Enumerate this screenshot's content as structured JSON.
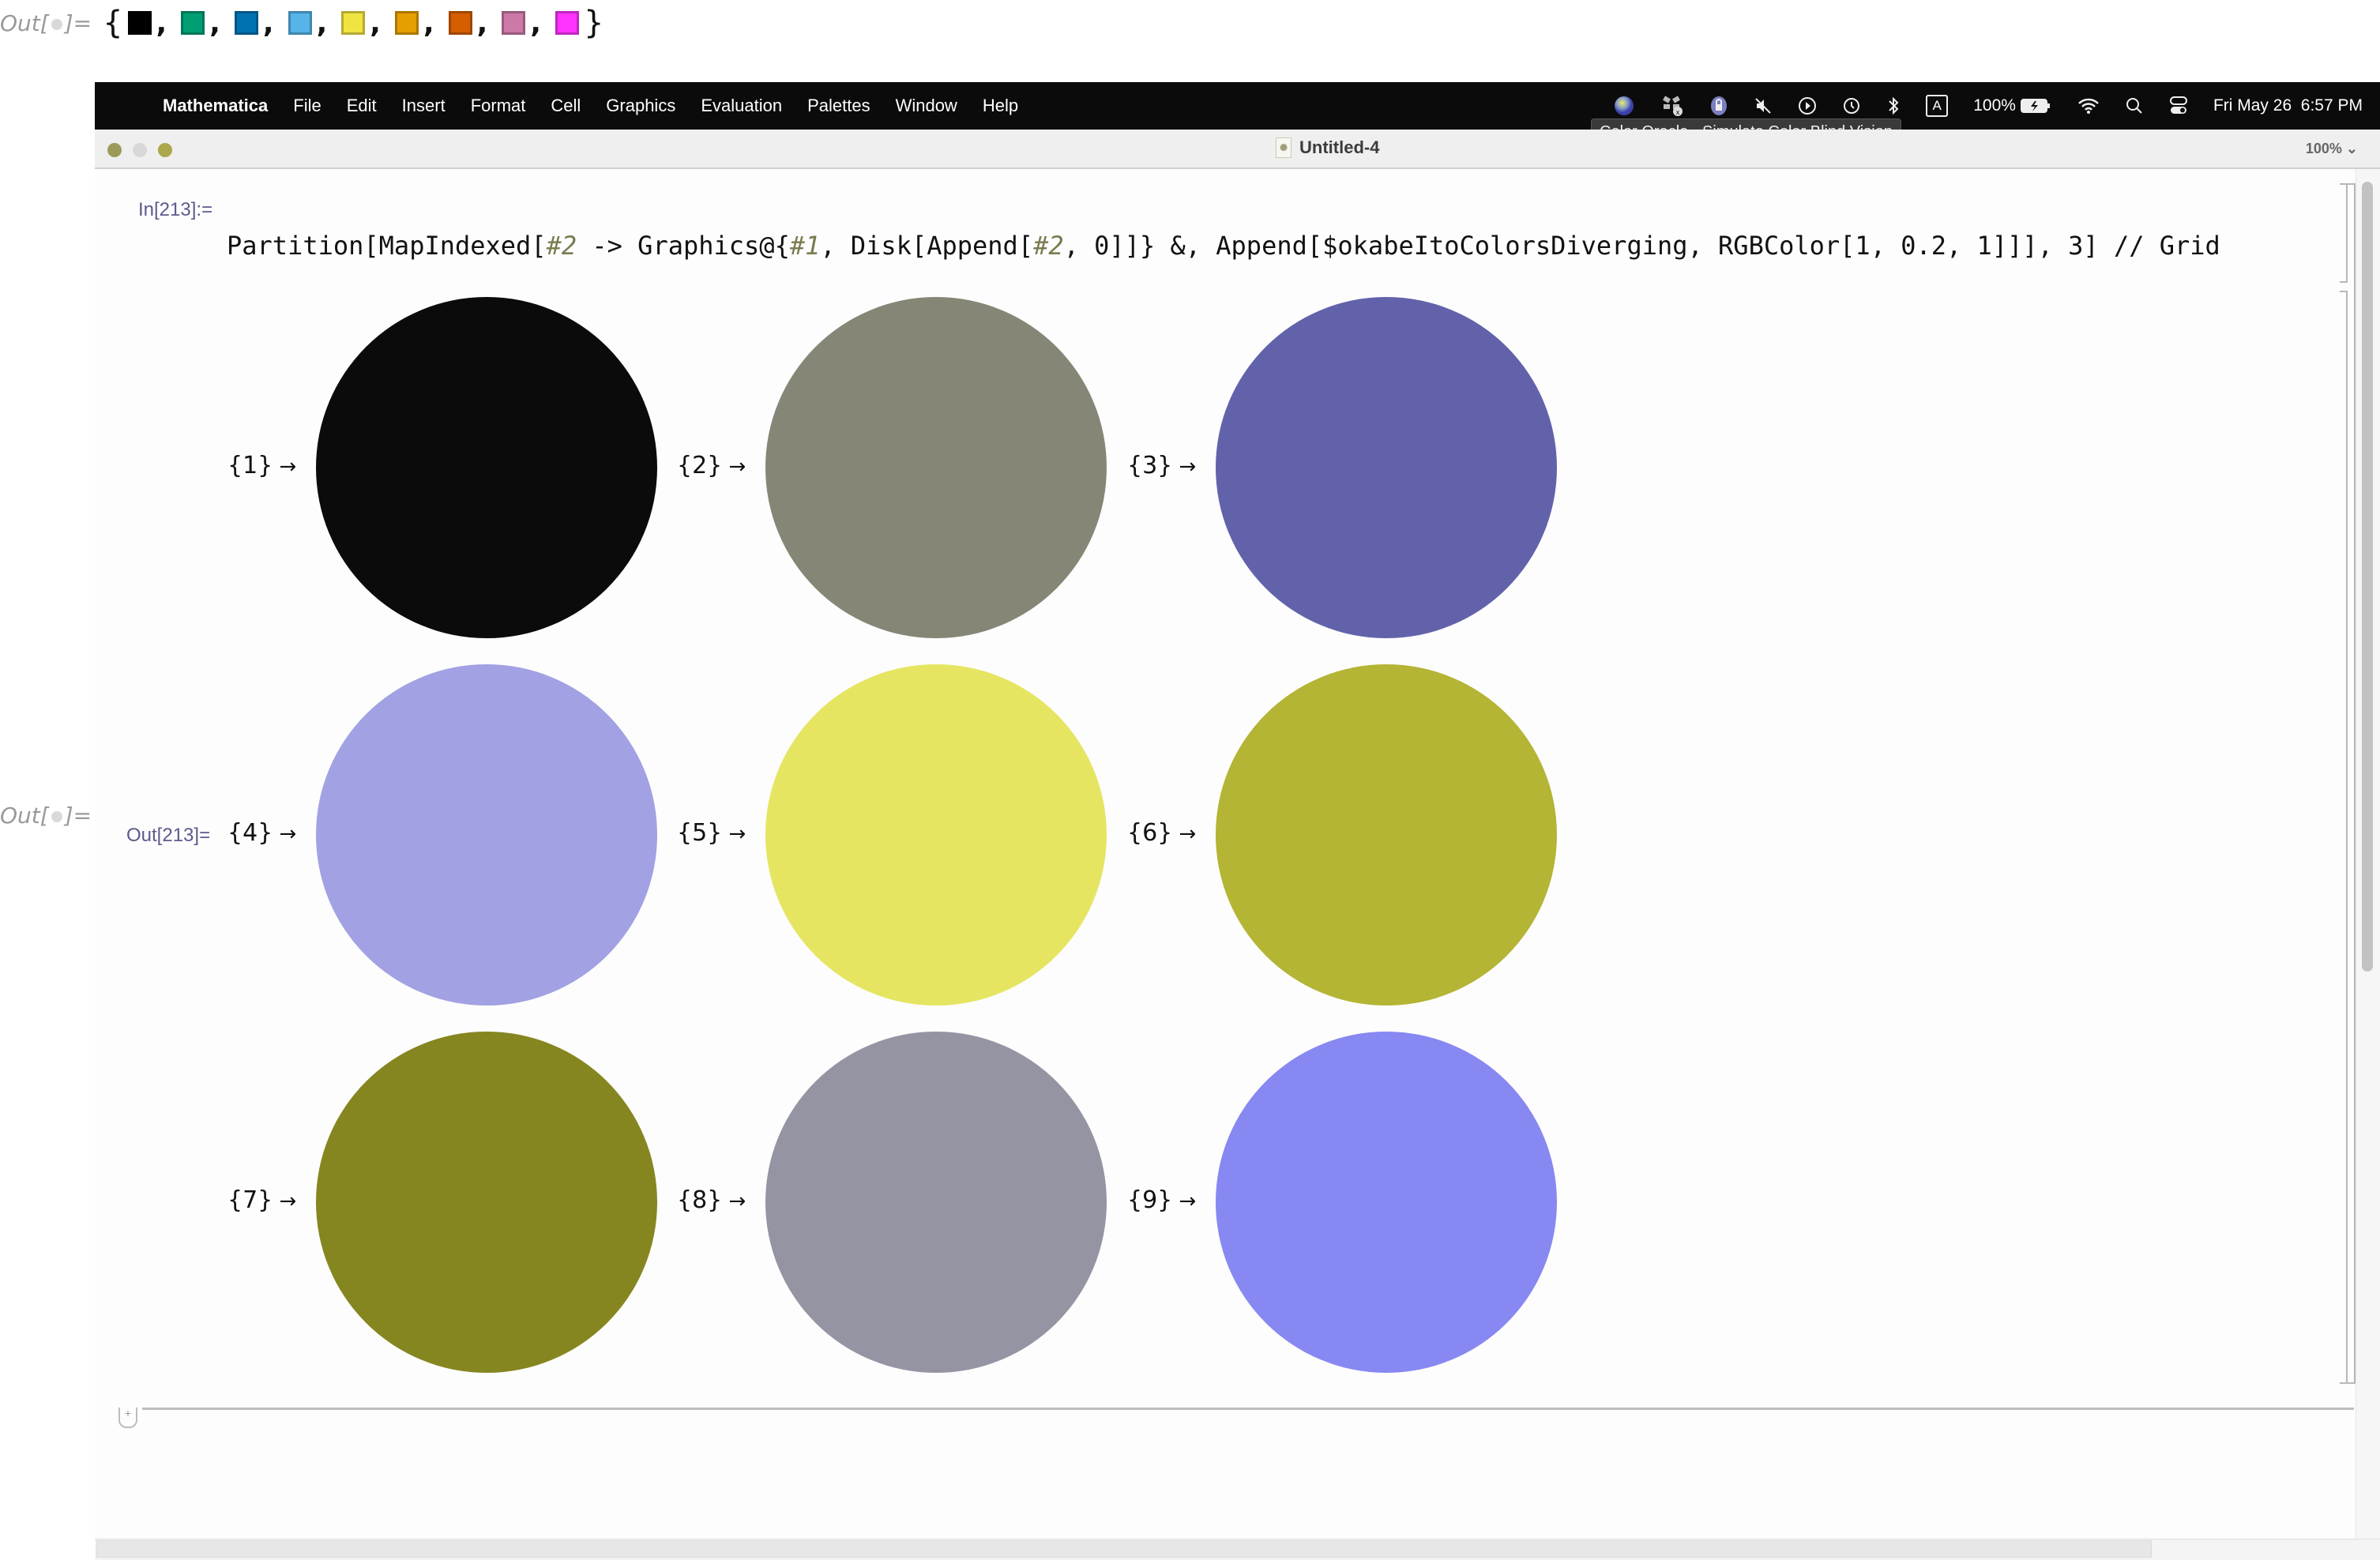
{
  "outer_output": {
    "label_prefix": "Out[",
    "label_suffix": "]=",
    "open_brace": "{",
    "close_brace": "}",
    "comma": ",",
    "swatches": [
      "#000000",
      "#009E73",
      "#0072B2",
      "#56B4E9",
      "#F0E442",
      "#E69F00",
      "#D55E00",
      "#CC79A7",
      "#FF33FF"
    ]
  },
  "menubar": {
    "apple_icon": "",
    "app_name": "Mathematica",
    "items": [
      "File",
      "Edit",
      "Insert",
      "Format",
      "Cell",
      "Graphics",
      "Evaluation",
      "Palettes",
      "Window",
      "Help"
    ],
    "status": {
      "battery_percent": "100%",
      "input_source": "A",
      "datetime": "Fri May 26  6:57 PM"
    },
    "tooltip": "Color Oracle - Simulate Color Blind Vision"
  },
  "window": {
    "title": "Untitled-4",
    "zoom": "100%",
    "traffic_lights": [
      "#9c9a58",
      "#d8d8d8",
      "#aaa84a"
    ]
  },
  "notebook": {
    "input_label": "In[213]:=",
    "code_parts": [
      {
        "t": "Partition[MapIndexed[",
        "slot": false
      },
      {
        "t": "#2",
        "slot": true
      },
      {
        "t": " -> Graphics@{",
        "slot": false
      },
      {
        "t": "#1",
        "slot": true
      },
      {
        "t": ", Disk[Append[",
        "slot": false
      },
      {
        "t": "#2",
        "slot": true
      },
      {
        "t": ", 0]]} &, Append[$okabeItoColorsDiverging, RGBColor[1, 0.2, 1]]], 3] // Grid",
        "slot": false
      }
    ],
    "outer_output_label": "Out[•]=",
    "output_label": "Out[213]=",
    "grid": [
      {
        "index": "{1}",
        "arrow": "→",
        "color": "#0b0b0b"
      },
      {
        "index": "{2}",
        "arrow": "→",
        "color": "#868676"
      },
      {
        "index": "{3}",
        "arrow": "→",
        "color": "#6262ab"
      },
      {
        "index": "{4}",
        "arrow": "→",
        "color": "#a1a1e3"
      },
      {
        "index": "{5}",
        "arrow": "→",
        "color": "#e5e562"
      },
      {
        "index": "{6}",
        "arrow": "→",
        "color": "#b4b435"
      },
      {
        "index": "{7}",
        "arrow": "→",
        "color": "#858620"
      },
      {
        "index": "{8}",
        "arrow": "→",
        "color": "#9594a3"
      },
      {
        "index": "{9}",
        "arrow": "→",
        "color": "#8888f2"
      }
    ]
  }
}
